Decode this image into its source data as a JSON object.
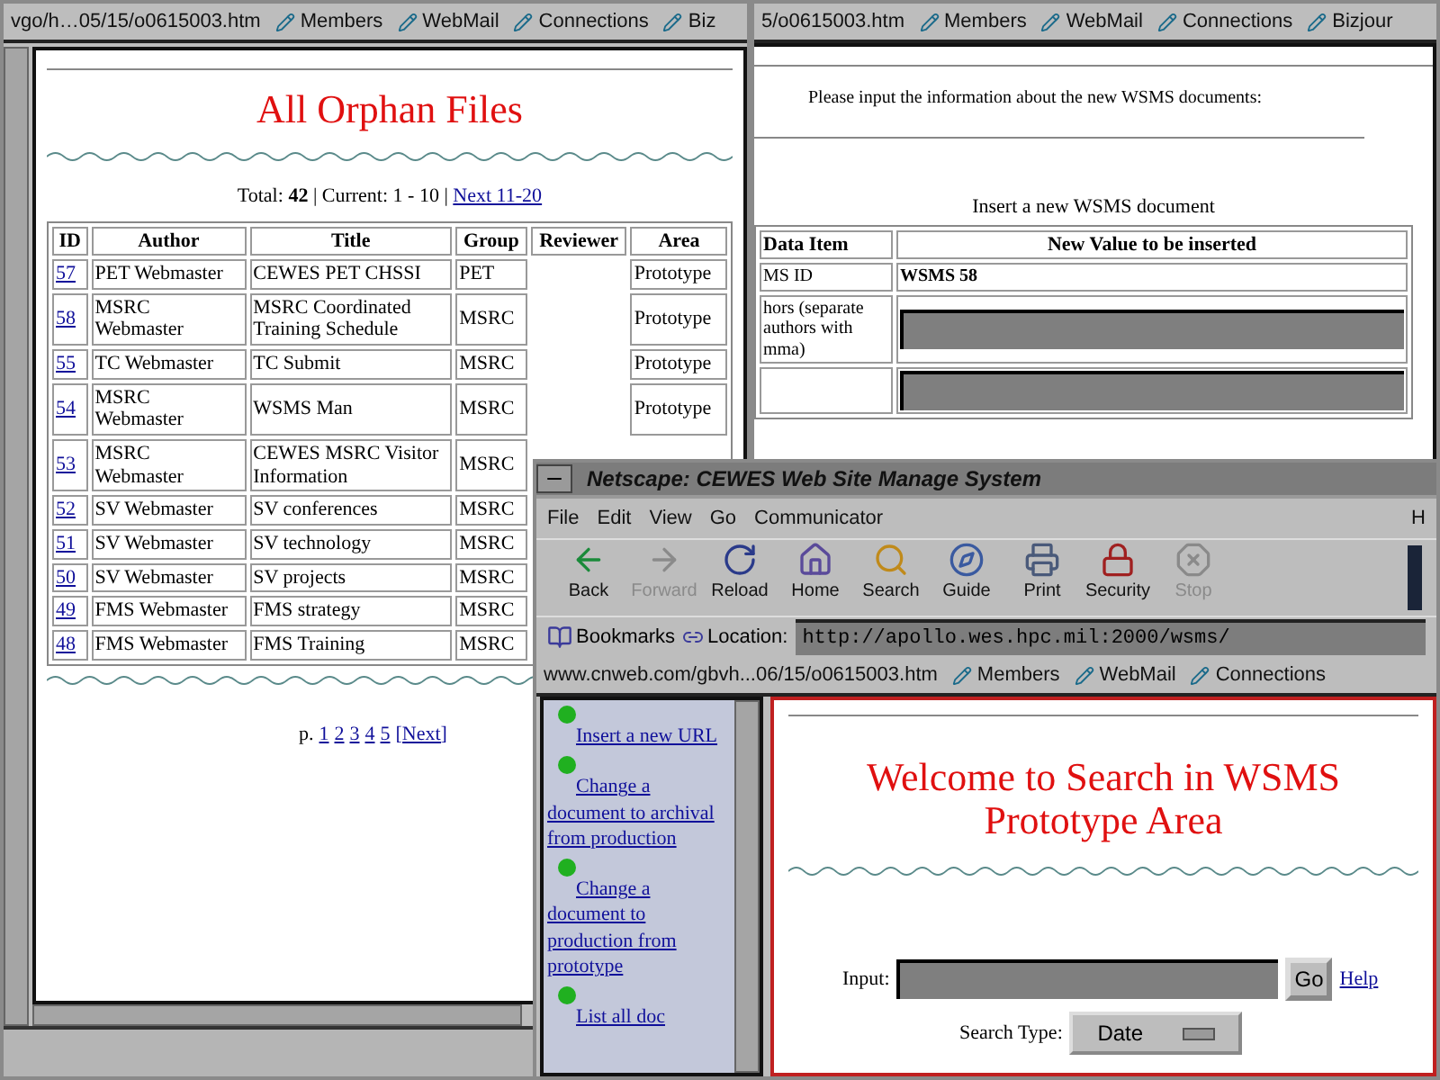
{
  "orphan_window": {
    "bookmark_bar": {
      "url": "vgo/h…05/15/o0615003.htm",
      "links": [
        "Members",
        "WebMail",
        "Connections",
        "Biz"
      ]
    },
    "heading": "All Orphan Files",
    "summary": "Total: **42** |   Current: 1 - 10 |",
    "next_link": "Next 11-20",
    "table": {
      "columns": [
        "ID",
        "Author",
        "Title",
        "Group",
        "Reviewer",
        "Area"
      ],
      "rows": [
        {
          "id": "57",
          "author": "PET Webmaster",
          "title": "CEWES PET CHSSI",
          "group": "PET",
          "area": "Prototype"
        },
        {
          "id": "58",
          "author": "MSRC Webmaster",
          "title": "MSRC Coordinated Training Schedule",
          "group": "MSRC",
          "area": "Prototype"
        },
        {
          "id": "55",
          "author": "TC Webmaster",
          "title": "TC Submit",
          "group": "MSRC",
          "area": "Prototype"
        },
        {
          "id": "54",
          "author": "MSRC Webmaster",
          "title": "WSMS Man",
          "group": "MSRC",
          "area": "Prototype"
        },
        {
          "id": "53",
          "author": "MSRC Webmaster",
          "title": "CEWES MSRC Visitor Information",
          "group": "MSRC"
        },
        {
          "id": "52",
          "author": "SV Webmaster",
          "title": "SV conferences",
          "group": "MSRC"
        },
        {
          "id": "51",
          "author": "SV Webmaster",
          "title": "SV technology",
          "group": "MSRC"
        },
        {
          "id": "50",
          "author": "SV Webmaster",
          "title": "SV projects",
          "group": "MSRC"
        },
        {
          "id": "49",
          "author": "FMS Webmaster",
          "title": "FMS strategy",
          "group": "MSRC"
        },
        {
          "id": "48",
          "author": "FMS Webmaster",
          "title": "FMS Training",
          "group": "MSRC"
        }
      ]
    },
    "pager": {
      "label": "p.",
      "pages": [
        "1",
        "2",
        "3",
        "4",
        "5"
      ],
      "next": "[Next]"
    }
  },
  "insert_window": {
    "bookmark_bar": {
      "url": "5/o0615003.htm",
      "links": [
        "Members",
        "WebMail",
        "Connections",
        "Bizjour"
      ]
    },
    "intro": "Please input the information about the new WSMS documents:",
    "caption": "Insert a new WSMS document",
    "columns": [
      "Data Item",
      "New Value to be inserted"
    ],
    "rows": [
      {
        "kind": "text",
        "label": "MS ID",
        "value": "WSMS 58"
      },
      {
        "kind": "input",
        "label": "hors (separate authors with mma)"
      },
      {
        "kind": "input"
      }
    ]
  },
  "browser_window": {
    "title": "Netscape: CEWES Web Site Manage System",
    "menu": [
      "File",
      "Edit",
      "View",
      "Go",
      "Communicator",
      "H"
    ],
    "toolbar": [
      {
        "kind": "back",
        "label": "Back",
        "disabled": false
      },
      {
        "kind": "forward",
        "label": "Forward",
        "disabled": true
      },
      {
        "kind": "reload",
        "label": "Reload",
        "disabled": false
      },
      {
        "kind": "home",
        "label": "Home",
        "disabled": false
      },
      {
        "kind": "search",
        "label": "Search",
        "disabled": false
      },
      {
        "kind": "guide",
        "label": "Guide",
        "disabled": false
      },
      {
        "kind": "print",
        "label": "Print",
        "disabled": false
      },
      {
        "kind": "security",
        "label": "Security",
        "disabled": false
      },
      {
        "kind": "stop",
        "label": "Stop",
        "disabled": true
      }
    ],
    "bookmarks_label": "Bookmarks",
    "location_label": "Location:",
    "location": "http://apollo.wes.hpc.mil:2000/wsms/",
    "bookmark_bar": {
      "url": "www.cnweb.com/gbvh...06/15/o0615003.htm",
      "links": [
        "Members",
        "WebMail",
        "Connections"
      ]
    },
    "nav_links": [
      "Insert a new URL",
      "Change a document to archival from production",
      "Change a document to production from prototype",
      "List all doc"
    ],
    "heading": "Welcome to Search in WSMS Prototype Area",
    "input_label": "Input:",
    "go_button": "Go",
    "help_link": "Help",
    "search_type_label": "Search Type:",
    "search_type": "Date"
  }
}
